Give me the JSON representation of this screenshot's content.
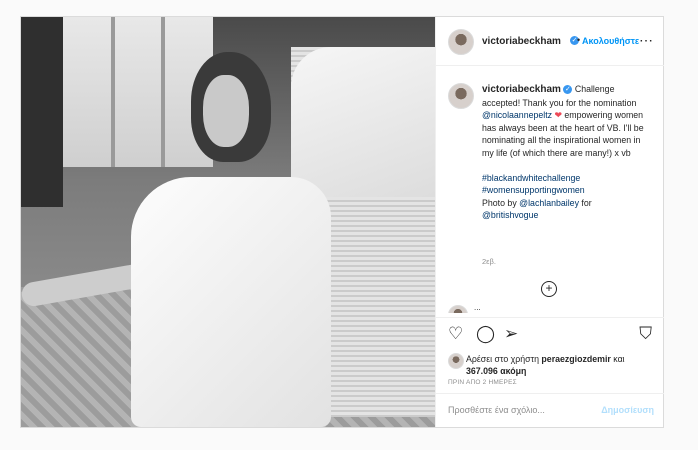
{
  "post": {
    "username": "victoriabeckham",
    "follow_label": "Ακολουθήστε",
    "more_icon": "more-dots-icon",
    "caption": {
      "username": "victoriabeckham",
      "text_1": "Challenge accepted! Thank you for the nomination ",
      "mention_1": "@nicolaannepeltz",
      "text_2": " empowering women has always been at the heart of VB. I'll be nominating all the inspirational women in my life (of which there are many!) x vb",
      "hashtag_1": "#blackandwhitechallenge",
      "hashtag_2": "#womensupportingwomen",
      "photo_by": "Photo by ",
      "mention_2": "@lachlanbailey",
      "for": " for",
      "mention_3": "@britishvogue",
      "time": "2εβ."
    },
    "peek_comment": "...",
    "likes": {
      "prefix": "Αρέσει στο χρήστη ",
      "user": "peraezgiozdemir",
      "suffix": " και",
      "count": "367.096 ακόμη"
    },
    "date": "ΠΡΙΝ ΑΠΟ 2 ΗΜΕΡΕΣ",
    "comment_placeholder": "Προσθέστε ένα σχόλιο...",
    "post_button": "Δημοσίευση"
  }
}
